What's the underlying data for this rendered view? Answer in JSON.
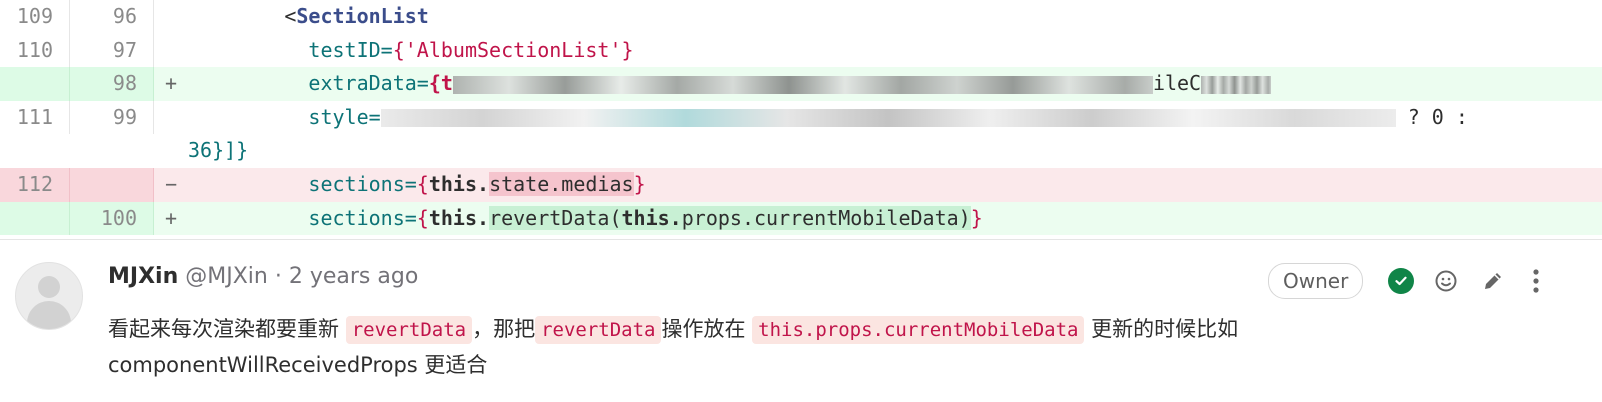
{
  "diff": {
    "rows": [
      {
        "old": "109",
        "new": "96",
        "sign": "",
        "pre": "        <",
        "tag": "SectionList"
      },
      {
        "old": "110",
        "new": "97",
        "sign": "",
        "pre": "          ",
        "attr": "testID=",
        "str": "{'AlbumSectionList'}"
      },
      {
        "old": "",
        "new": "98",
        "sign": "+",
        "pre": "          ",
        "attr": "extraData=",
        "open": "{t",
        "tail": "ileC"
      },
      {
        "old": "111",
        "new": "99",
        "sign": "",
        "pre": "          ",
        "attr": "style=",
        "tail": "? 0 :"
      },
      {
        "cont": "36}]}"
      },
      {
        "old": "112",
        "new": "",
        "sign": "−",
        "pre": "          ",
        "attr": "sections=",
        "kw": "this.",
        "hl": "state.medias",
        "close": "}"
      },
      {
        "old": "",
        "new": "100",
        "sign": "+",
        "pre": "          ",
        "attr": "sections=",
        "kw": "this.",
        "hl": "revertData(",
        "kw2": "this.",
        "rest": "props.currentMobileData)",
        "close": "}"
      }
    ]
  },
  "comment": {
    "author": "MJXin",
    "handle": "@MJXin",
    "time": "· 2 years ago",
    "badge": "Owner",
    "icons": [
      "check-circle-icon",
      "smiley-icon",
      "pencil-icon",
      "more-vertical-icon"
    ],
    "text_1": "看起来每次渲染都要重新",
    "code_1": "revertData",
    "text_2": "，那把",
    "code_2": "revertData",
    "text_3": "操作放在",
    "code_3": "this.props.currentMobileData",
    "text_4": "更新的时候比如",
    "text_5": "componentWillReceivedProps 更适合"
  }
}
